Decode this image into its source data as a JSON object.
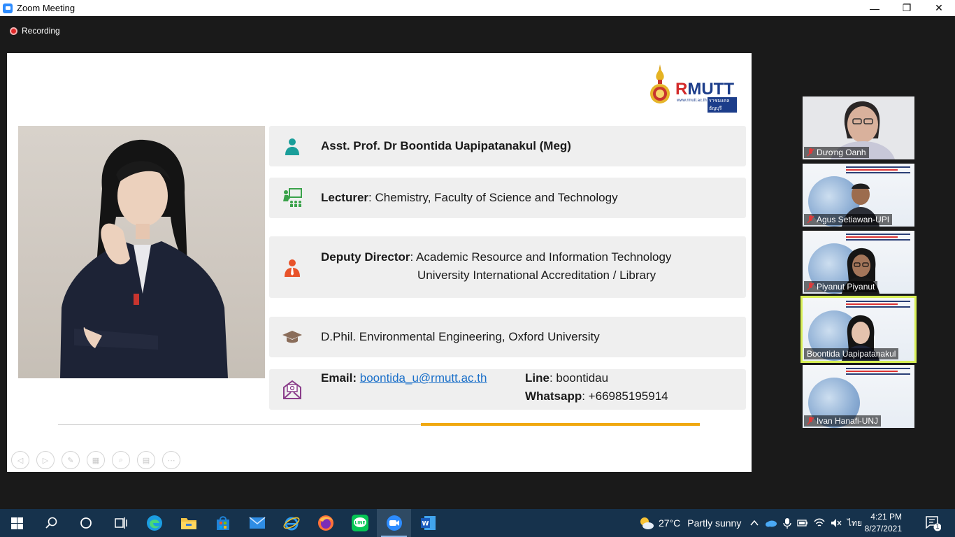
{
  "window": {
    "title": "Zoom Meeting",
    "minimize_glyph": "—",
    "restore_glyph": "❐",
    "close_glyph": "✕"
  },
  "recording": {
    "label": "Recording",
    "color": "#e02828"
  },
  "slide": {
    "logo": {
      "word_red": "R",
      "word_blue": "MUTT",
      "site": "www.rmutt.ac.th",
      "thai": "ราชมงคลธัญบุรี"
    },
    "profile": {
      "name": "Asst. Prof. Dr Boontida Uapipatanakul (Meg)",
      "lecturer_label": "Lecturer",
      "lecturer_text": ": Chemistry, Faculty of Science and Technology",
      "deputy_label": "Deputy Director",
      "deputy_line1": ": Academic Resource and Information Technology",
      "deputy_line2": "University International Accreditation / Library",
      "degree": "D.Phil. Environmental Engineering, Oxford University",
      "email_label": "Email:",
      "email": "boontida_u@rmutt.ac.th",
      "line_label": "Line",
      "line_value": ": boontidau",
      "whatsapp_label": "Whatsapp",
      "whatsapp_value": ": +66985195914"
    },
    "colors": {
      "accent_gold": "#f0a810",
      "icon_teal": "#1a9e9a",
      "icon_green": "#3aa24a",
      "icon_orange": "#e8532a",
      "icon_purple": "#8a3d8a"
    }
  },
  "participants": [
    {
      "name": "Dương Oanh",
      "muted": true,
      "active": false
    },
    {
      "name": "Agus Setiawan-UPI",
      "muted": true,
      "active": false
    },
    {
      "name": "Piyanut Piyanut",
      "muted": true,
      "active": false
    },
    {
      "name": "Boontida Uapipatanakul",
      "muted": false,
      "active": true
    },
    {
      "name": "Ivan Hanafi-UNJ",
      "muted": true,
      "active": false
    }
  ],
  "taskbar": {
    "weather": {
      "temp": "27°C",
      "condition": "Partly sunny"
    },
    "language": "ไทย",
    "time": "4:21 PM",
    "date": "8/27/2021",
    "notification_count": "1"
  }
}
